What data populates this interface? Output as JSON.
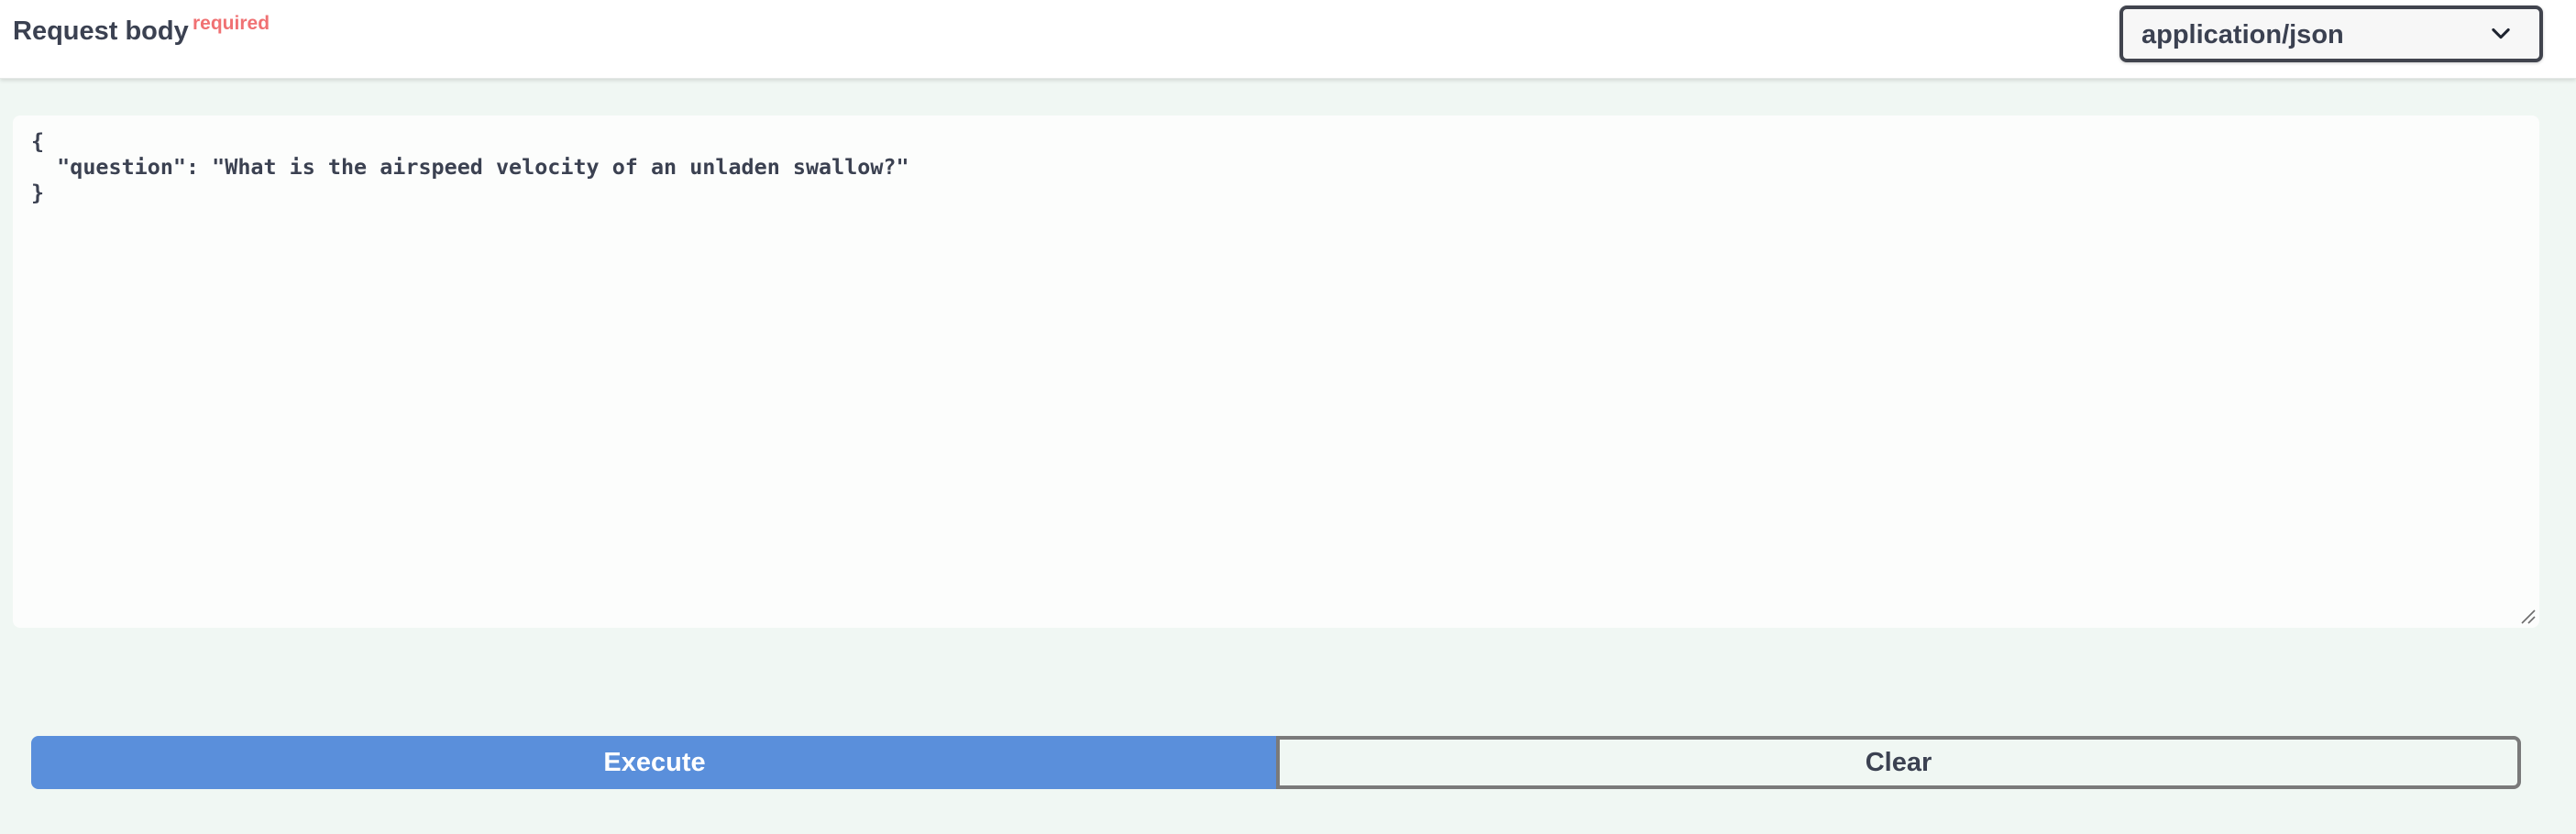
{
  "header": {
    "title": "Request body",
    "required_label": "required",
    "content_type": {
      "selected": "application/json",
      "icon": "chevron-down-icon"
    }
  },
  "editor": {
    "body": "{\n  \"question\": \"What is the airspeed velocity of an unladen swallow?\"\n}"
  },
  "actions": {
    "execute_label": "Execute",
    "clear_label": "Clear"
  },
  "colors": {
    "background": "#f0f7f3",
    "execute": "#5a8fdb",
    "required": "#f07173",
    "text": "#3b4151"
  }
}
